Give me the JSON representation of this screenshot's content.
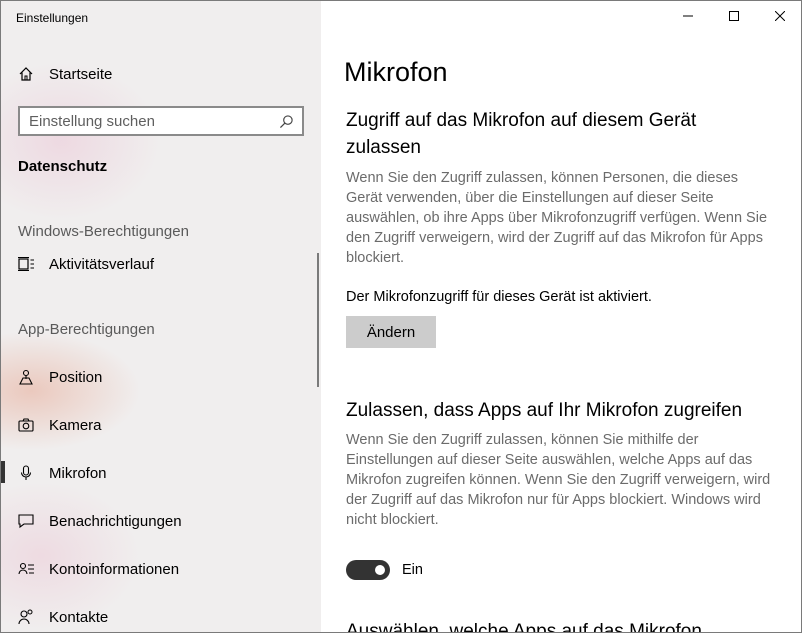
{
  "window": {
    "title": "Einstellungen"
  },
  "sidebar": {
    "home_label": "Startseite",
    "search_placeholder": "Einstellung suchen",
    "section_title": "Datenschutz",
    "group_windows": "Windows-Berechtigungen",
    "windows_items": [
      {
        "label": "Aktivitätsverlauf",
        "icon": "activity-history-icon"
      }
    ],
    "group_apps": "App-Berechtigungen",
    "app_items": [
      {
        "label": "Position",
        "icon": "location-icon"
      },
      {
        "label": "Kamera",
        "icon": "camera-icon"
      },
      {
        "label": "Mikrofon",
        "icon": "microphone-icon",
        "active": true
      },
      {
        "label": "Benachrichtigungen",
        "icon": "notifications-icon"
      },
      {
        "label": "Kontoinformationen",
        "icon": "account-info-icon"
      },
      {
        "label": "Kontakte",
        "icon": "contacts-icon"
      }
    ]
  },
  "main": {
    "page_title": "Mikrofon",
    "section1": {
      "heading": "Zugriff auf das Mikrofon auf diesem Gerät zulassen",
      "description": "Wenn Sie den Zugriff zulassen, können Personen, die dieses Gerät verwenden, über die Einstellungen auf dieser Seite auswählen, ob ihre Apps über Mikrofonzugriff verfügen. Wenn Sie den Zugriff verweigern, wird der Zugriff auf das Mikrofon für Apps blockiert.",
      "status": "Der Mikrofonzugriff für dieses Gerät ist aktiviert.",
      "button_label": "Ändern"
    },
    "section2": {
      "heading": "Zulassen, dass Apps auf Ihr Mikrofon zugreifen",
      "description": "Wenn Sie den Zugriff zulassen, können Sie mithilfe der Einstellungen auf dieser Seite auswählen, welche Apps auf das Mikrofon zugreifen können. Wenn Sie den Zugriff verweigern, wird der Zugriff auf das Mikrofon nur für Apps blockiert. Windows wird nicht blockiert.",
      "toggle_state": true,
      "toggle_label": "Ein"
    },
    "section3": {
      "heading": "Auswählen, welche Apps auf das Mikrofon"
    }
  }
}
